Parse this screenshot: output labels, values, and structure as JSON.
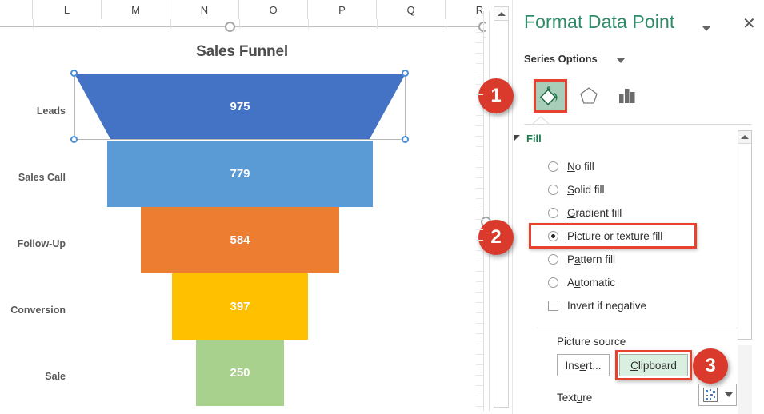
{
  "worksheet": {
    "column_headers": [
      "L",
      "M",
      "N",
      "O",
      "P",
      "Q",
      "R"
    ]
  },
  "chart_data": {
    "type": "bar",
    "title": "Sales Funnel",
    "categories": [
      "Leads",
      "Sales Call",
      "Follow-Up",
      "Conversion",
      "Sale"
    ],
    "values": [
      975,
      779,
      584,
      397,
      250
    ],
    "colors": [
      "#4472C4",
      "#5B9BD5",
      "#ED7D31",
      "#FFC000",
      "#A9D18E"
    ],
    "xlabel": "",
    "ylabel": "",
    "grid": false,
    "legend": "none",
    "data_labels": [
      "975",
      "779",
      "584",
      "397",
      "250"
    ],
    "selected_point": "Leads"
  },
  "pane": {
    "title": "Format Data Point",
    "close_label": "✕",
    "section": "Series Options",
    "tabs": [
      {
        "name": "fill-line",
        "icon": "paint-bucket-icon",
        "selected": true
      },
      {
        "name": "effects",
        "icon": "pentagon-icon",
        "selected": false
      },
      {
        "name": "series-options",
        "icon": "bar-chart-icon",
        "selected": false
      }
    ],
    "fill": {
      "header": "Fill",
      "options": [
        {
          "label": "No fill",
          "underline": "N",
          "selected": false
        },
        {
          "label": "Solid fill",
          "underline": "S",
          "selected": false
        },
        {
          "label": "Gradient fill",
          "underline": "G",
          "selected": false
        },
        {
          "label": "Picture or texture fill",
          "underline": "P",
          "selected": true
        },
        {
          "label": "Pattern fill",
          "underline": "a",
          "selected": false
        },
        {
          "label": "Automatic",
          "underline": "u",
          "selected": false
        }
      ],
      "invert_if_negative": {
        "label": "Invert if negative",
        "checked": false
      }
    },
    "picture_source": {
      "label": "Picture source",
      "insert_label": "Insert...",
      "clipboard_label": "Clipboard"
    },
    "texture": {
      "label": "Texture"
    }
  },
  "callouts": [
    {
      "number": "1",
      "target": "fill-tab-icon"
    },
    {
      "number": "2",
      "target": "picture-or-texture-fill-option"
    },
    {
      "number": "3",
      "target": "clipboard-button"
    }
  ],
  "colors": {
    "pane_title": "#2E8B68",
    "fill_header": "#1F7A4D",
    "highlight": "#E8412E",
    "badge": "#D93A2B",
    "clipboard_bg": "#D9EFE0"
  }
}
